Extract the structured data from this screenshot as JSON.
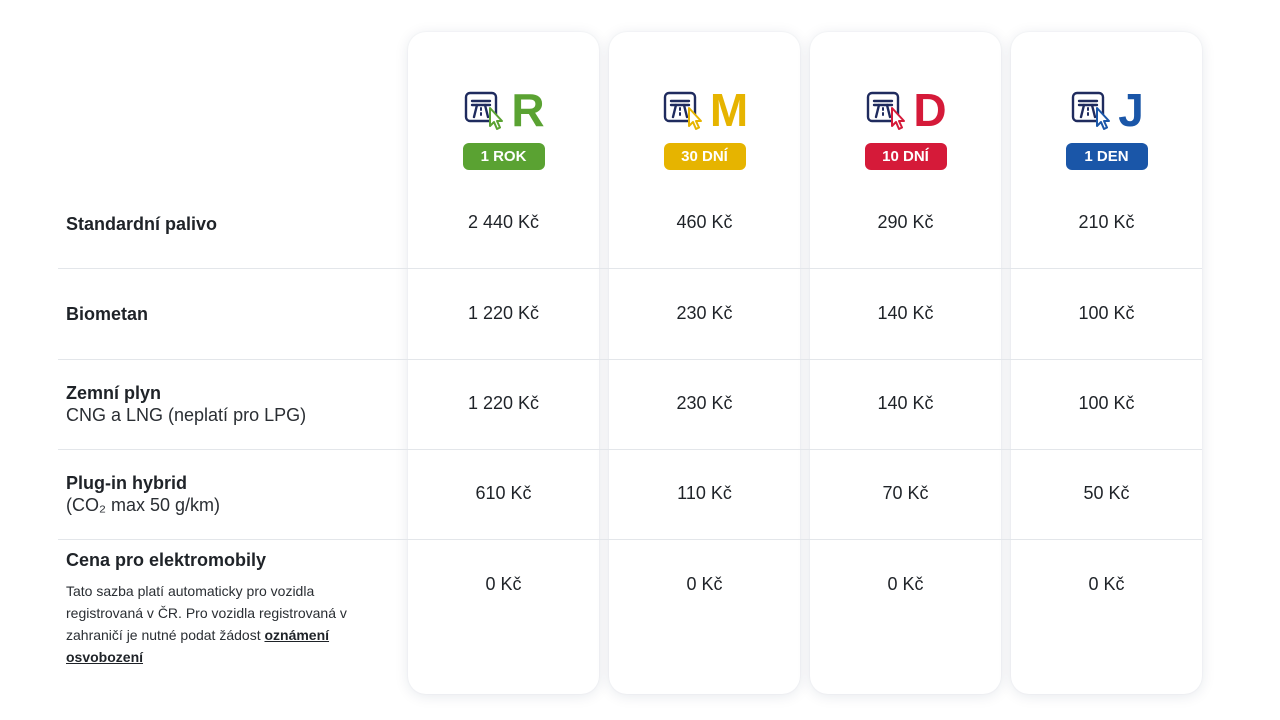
{
  "passes": [
    {
      "letter": "R",
      "badge": "1 ROK",
      "color": "#5aa232"
    },
    {
      "letter": "M",
      "badge": "30 DNÍ",
      "color": "#e6b400"
    },
    {
      "letter": "D",
      "badge": "10 DNÍ",
      "color": "#d51a39"
    },
    {
      "letter": "J",
      "badge": "1 DEN",
      "color": "#1a56a8"
    }
  ],
  "rows": [
    {
      "title": "Standardní palivo",
      "prices": [
        "2 440 Kč",
        "460 Kč",
        "290 Kč",
        "210 Kč"
      ]
    },
    {
      "title": "Biometan",
      "prices": [
        "1 220 Kč",
        "230 Kč",
        "140 Kč",
        "100 Kč"
      ]
    },
    {
      "title": "Zemní plyn",
      "subtitle": "CNG a LNG (neplatí pro LPG)",
      "prices": [
        "1 220 Kč",
        "230 Kč",
        "140 Kč",
        "100 Kč"
      ]
    },
    {
      "title": "Plug-in hybrid",
      "subtitle": "(CO₂ max 50 g/km)",
      "prices": [
        "610 Kč",
        "110 Kč",
        "70 Kč",
        "50 Kč"
      ]
    },
    {
      "title": "Cena pro elektromobily",
      "note": "Tato sazba platí automaticky pro vozidla registrovaná v ČR. Pro vozidla registrovaná v zahraničí je nutné podat žádost",
      "link": "oznámení osvobození",
      "prices": [
        "0 Kč",
        "0 Kč",
        "0 Kč",
        "0 Kč"
      ]
    }
  ]
}
